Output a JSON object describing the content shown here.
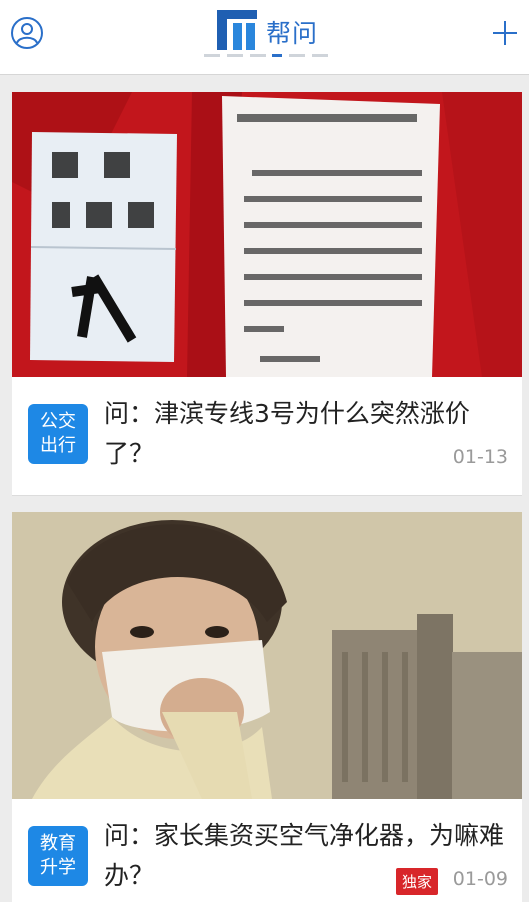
{
  "header": {
    "brand": "帮问",
    "logo_icon": "bangwen-logo-icon",
    "left_icon": "user-profile-icon",
    "right_icon": "plus-icon",
    "accent_color": "#2a6fc9"
  },
  "feed": [
    {
      "image": "photo-red-notice-board",
      "category": [
        "公交",
        "出行"
      ],
      "title": "问：津滨专线3号为什么突然涨价了？",
      "date": "01-13",
      "badge": ""
    },
    {
      "image": "photo-boy-with-mask",
      "category": [
        "教育",
        "升学"
      ],
      "title": "问：家长集资买空气净化器，为嘛难办？",
      "date": "01-09",
      "badge": "独家"
    }
  ]
}
